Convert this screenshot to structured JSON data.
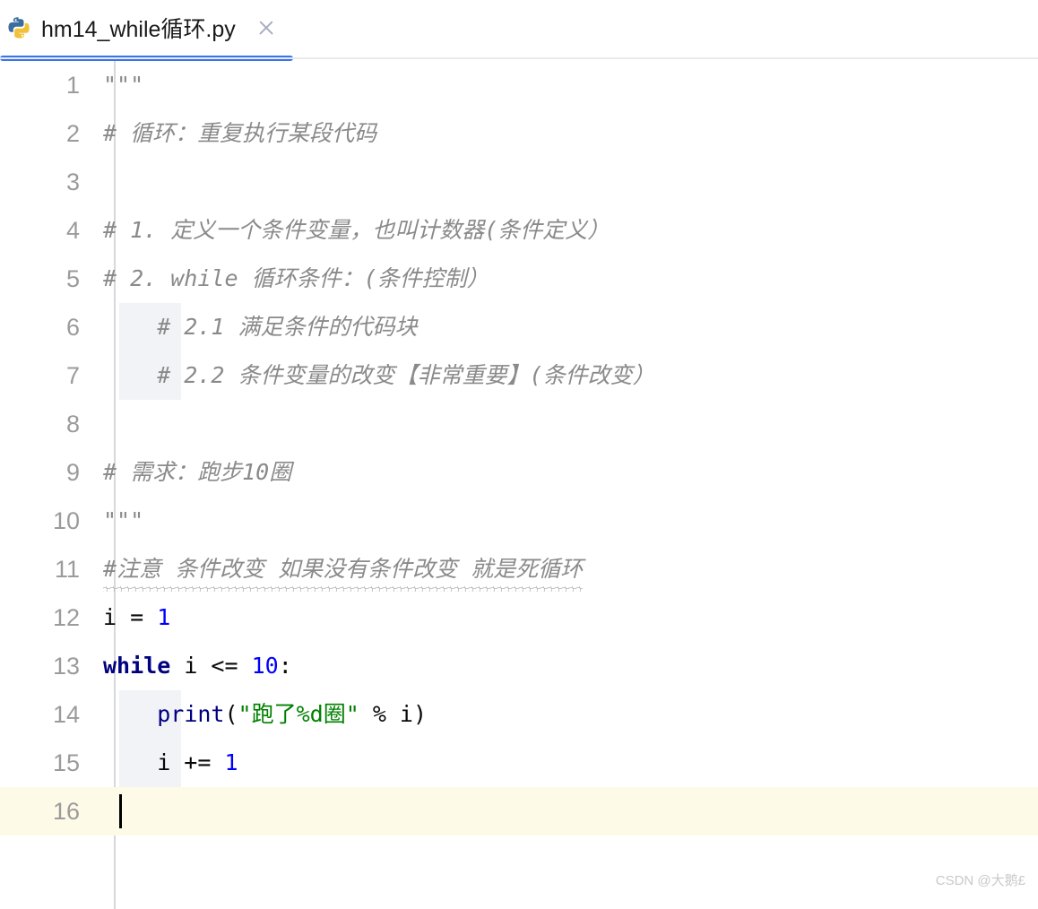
{
  "window": {
    "app_kind": "python-code-editor"
  },
  "tab": {
    "icon": "python-file-icon",
    "title": "hm14_while循环.py",
    "close_label": "×",
    "active": true,
    "accent_color": "#3874f2"
  },
  "editor": {
    "current_line": 16,
    "current_line_color": "#fdfae7",
    "gutter_color": "#9b9b9b",
    "colors": {
      "comment": "#8a8a8a",
      "keyword": "#000080",
      "number": "#0000ff",
      "string": "#008000",
      "plain": "#080808",
      "indent_block": "#f2f3f7",
      "squiggle": "#b9b9b9"
    },
    "lines": [
      {
        "n": "1",
        "tokens": [
          {
            "t": "\"\"\"",
            "c": "cmt"
          }
        ]
      },
      {
        "n": "2",
        "tokens": [
          {
            "t": "# 循环：重复执行某段代码",
            "c": "cmt"
          }
        ]
      },
      {
        "n": "3",
        "tokens": [
          {
            "t": "",
            "c": "plain"
          }
        ]
      },
      {
        "n": "4",
        "tokens": [
          {
            "t": "# 1. 定义一个条件变量，也叫计数器(条件定义）",
            "c": "cmt"
          }
        ]
      },
      {
        "n": "5",
        "tokens": [
          {
            "t": "# 2. while 循环条件：(条件控制）",
            "c": "cmt"
          }
        ]
      },
      {
        "n": "6",
        "tokens": [
          {
            "t": "    # 2.1 满足条件的代码块",
            "c": "cmt"
          }
        ]
      },
      {
        "n": "7",
        "tokens": [
          {
            "t": "    # 2.2 条件变量的改变【非常重要】(条件改变）",
            "c": "cmt"
          }
        ]
      },
      {
        "n": "8",
        "tokens": [
          {
            "t": "",
            "c": "plain"
          }
        ]
      },
      {
        "n": "9",
        "tokens": [
          {
            "t": "# 需求：跑步10圈",
            "c": "cmt"
          }
        ]
      },
      {
        "n": "10",
        "tokens": [
          {
            "t": "\"\"\"",
            "c": "cmt"
          }
        ]
      },
      {
        "n": "11",
        "tokens": [
          {
            "t": "#注意 条件改变 如果没有条件改变 就是死循环",
            "c": "cmt",
            "squiggle": true
          }
        ]
      },
      {
        "n": "12",
        "tokens": [
          {
            "t": "i ",
            "c": "plain"
          },
          {
            "t": "= ",
            "c": "plain"
          },
          {
            "t": "1",
            "c": "num"
          }
        ]
      },
      {
        "n": "13",
        "tokens": [
          {
            "t": "while",
            "c": "kw"
          },
          {
            "t": " i <= ",
            "c": "plain"
          },
          {
            "t": "10",
            "c": "num"
          },
          {
            "t": ":",
            "c": "plain"
          }
        ]
      },
      {
        "n": "14",
        "tokens": [
          {
            "t": "    ",
            "c": "plain"
          },
          {
            "t": "print",
            "c": "fn"
          },
          {
            "t": "(",
            "c": "plain"
          },
          {
            "t": "\"跑了%d圈\"",
            "c": "str"
          },
          {
            "t": " % i)",
            "c": "plain"
          }
        ]
      },
      {
        "n": "15",
        "tokens": [
          {
            "t": "    i += ",
            "c": "plain"
          },
          {
            "t": "1",
            "c": "num"
          }
        ]
      },
      {
        "n": "16",
        "tokens": [
          {
            "t": "",
            "c": "plain"
          }
        ]
      }
    ]
  },
  "watermark": {
    "text": "CSDN @大鹅£"
  }
}
